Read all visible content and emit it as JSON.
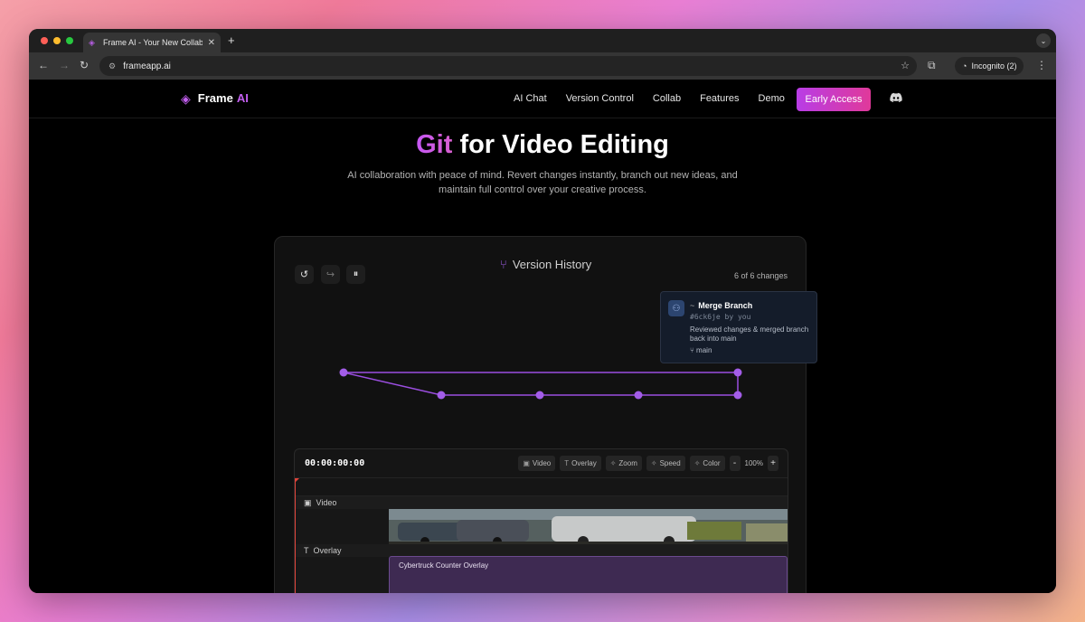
{
  "browser": {
    "tab_title": "Frame AI - Your New Collabo",
    "url": "frameapp.ai",
    "incognito_label": "Incognito (2)"
  },
  "site": {
    "logo_text": "Frame",
    "logo_accent": "AI",
    "nav": [
      "AI Chat",
      "Version Control",
      "Collab",
      "Features",
      "Demo"
    ],
    "cta": "Early Access",
    "accent_color": "#c35ff0"
  },
  "hero": {
    "title_accent": "Git",
    "title_rest": "for Video Editing",
    "subtitle": "AI collaboration with peace of mind. Revert changes instantly, branch out new ideas, and maintain full control over your creative process."
  },
  "version_history": {
    "title": "Version History",
    "changes_count": "6 of 6 changes",
    "tooltip": {
      "dash": "~",
      "title": "Merge Branch",
      "hash": "#6ck6je by you",
      "description": "Reviewed changes & merged branch back into main",
      "branch": "main"
    }
  },
  "editor": {
    "timecode": "00:00:00:00",
    "buttons": [
      "Video",
      "Overlay",
      "Zoom",
      "Speed",
      "Color"
    ],
    "zoom_minus": "-",
    "zoom_value": "100%",
    "zoom_plus": "+",
    "tracks": {
      "video_label": "Video",
      "overlay_label": "Overlay",
      "overlay_clip": "Cybertruck Counter Overlay"
    }
  }
}
